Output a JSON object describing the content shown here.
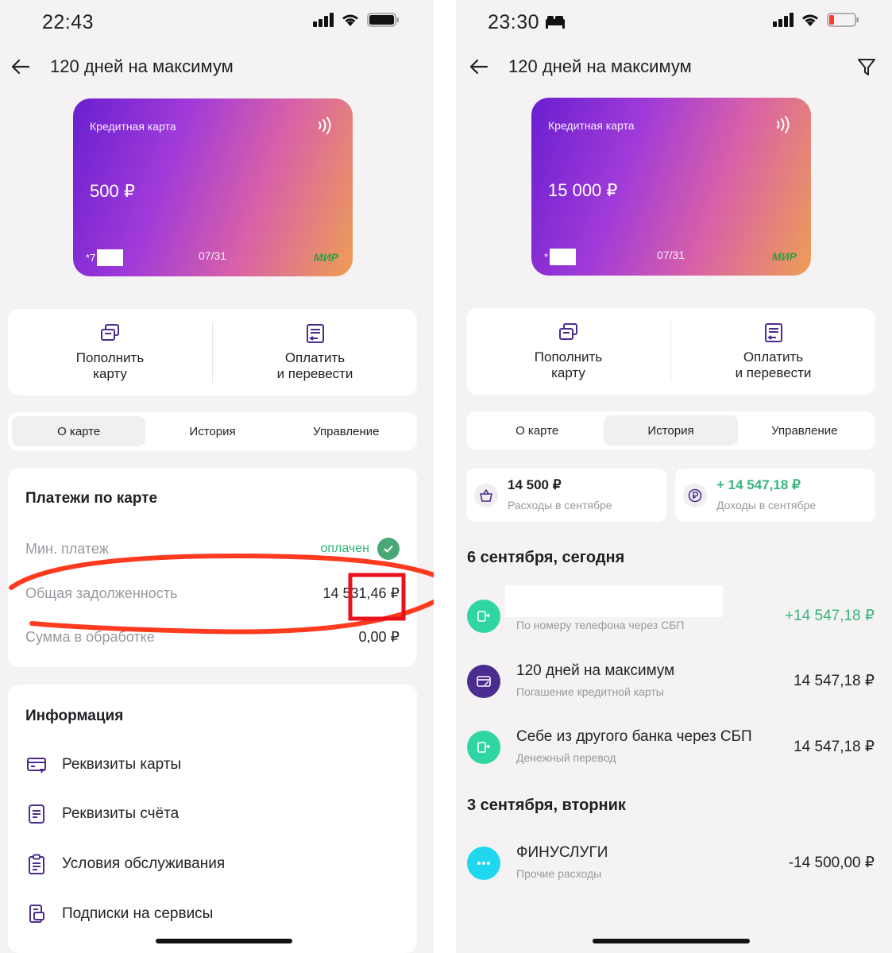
{
  "left": {
    "status": {
      "time": "22:43"
    },
    "header": {
      "title": "120 дней на максимум"
    },
    "card": {
      "type": "Кредитная карта",
      "balance": "500 ₽",
      "mask_prefix": "*7",
      "expiry": "07/31",
      "network": "МИР"
    },
    "actions": [
      {
        "label": "Пополнить\nкарту"
      },
      {
        "label": "Оплатить\nи перевести"
      }
    ],
    "tabs": [
      {
        "label": "О карте",
        "active": true
      },
      {
        "label": "История"
      },
      {
        "label": "Управление"
      }
    ],
    "payments": {
      "title": "Платежи по карте",
      "min_label": "Мин. платеж",
      "min_status": "оплачен",
      "debt_label": "Общая задолженность",
      "debt_value": "14 531,46 ₽",
      "processing_label": "Сумма в обработке",
      "processing_value": "0,00 ₽"
    },
    "info": {
      "title": "Информация",
      "items": [
        {
          "label": "Реквизиты карты",
          "icon": "card-details-icon"
        },
        {
          "label": "Реквизиты счёта",
          "icon": "document-icon"
        },
        {
          "label": "Условия обслуживания",
          "icon": "clipboard-icon"
        },
        {
          "label": "Подписки на сервисы",
          "icon": "subscription-icon"
        }
      ]
    },
    "annotation_color": "#ff3b1f"
  },
  "right": {
    "status": {
      "time": "23:30"
    },
    "header": {
      "title": "120 дней на максимум"
    },
    "card": {
      "type": "Кредитная карта",
      "balance": "15 000 ₽",
      "mask_prefix": "*",
      "expiry": "07/31",
      "network": "МИР"
    },
    "actions": [
      {
        "label": "Пополнить\nкарту"
      },
      {
        "label": "Оплатить\nи перевести"
      }
    ],
    "tabs": [
      {
        "label": "О карте"
      },
      {
        "label": "История",
        "active": true
      },
      {
        "label": "Управление"
      }
    ],
    "summary": {
      "expenses_amount": "14 500 ₽",
      "expenses_label": "Расходы в сентябре",
      "income_amount": "+ 14 547,18 ₽",
      "income_label": "Доходы в сентябре"
    },
    "days": [
      {
        "title": "6 сентября, сегодня",
        "transactions": [
          {
            "name": "",
            "desc": "По номеру телефона через СБП",
            "amount": "+14 547,18 ₽",
            "positive": true,
            "icon": "sbp-icon",
            "color": "#2fd6a3"
          },
          {
            "name": "120 дней на максимум",
            "desc": "Погашение кредитной карты",
            "amount": "14 547,18 ₽",
            "icon": "credit-card-icon",
            "color": "#4b2c8f"
          },
          {
            "name": "Себе из другого банка через СБП",
            "desc": "Денежный перевод",
            "amount": "14 547,18 ₽",
            "icon": "sbp-icon",
            "color": "#2fd6a3"
          }
        ]
      },
      {
        "title": "3 сентября, вторник",
        "transactions": [
          {
            "name": "ФИНУСЛУГИ",
            "desc": "Прочие расходы",
            "amount": "-14 500,00 ₽",
            "icon": "more-icon",
            "color": "#1fd8f0"
          }
        ]
      }
    ]
  }
}
